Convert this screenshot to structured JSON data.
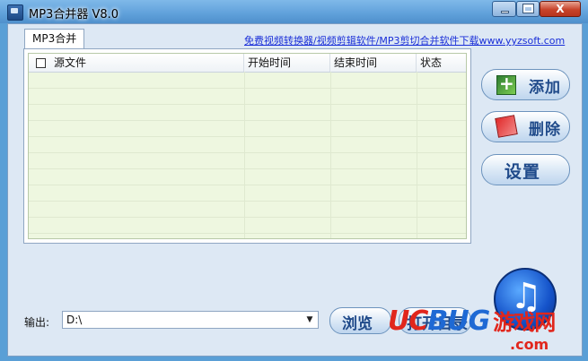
{
  "window": {
    "title": "MP3合并器 V8.0",
    "controls": {
      "minimize": "",
      "maximize": "",
      "close": "X"
    }
  },
  "tab": {
    "label": "MP3合并"
  },
  "top_link": {
    "text": "免费视频转换器/视频剪辑软件/MP3剪切合并软件下载www.yyzsoft.com"
  },
  "table": {
    "columns": [
      "源文件",
      "开始时间",
      "结束时间",
      "状态"
    ],
    "rows": []
  },
  "side_buttons": {
    "add": "添加",
    "delete": "删除",
    "settings": "设置"
  },
  "output": {
    "label": "输出:",
    "value": "D:\\",
    "browse": "浏览",
    "open": "打开目录"
  },
  "watermark": {
    "uc": "UC",
    "bug": "BUG",
    "cn": "游戏网",
    "domain": ".com"
  },
  "colors": {
    "accent": "#1f4a8a",
    "list_bg": "#eef7e0",
    "link": "#1a2fd8",
    "close_button": "#c7432a",
    "watermark_red": "#e1261c",
    "watermark_blue": "#1e69d4"
  }
}
